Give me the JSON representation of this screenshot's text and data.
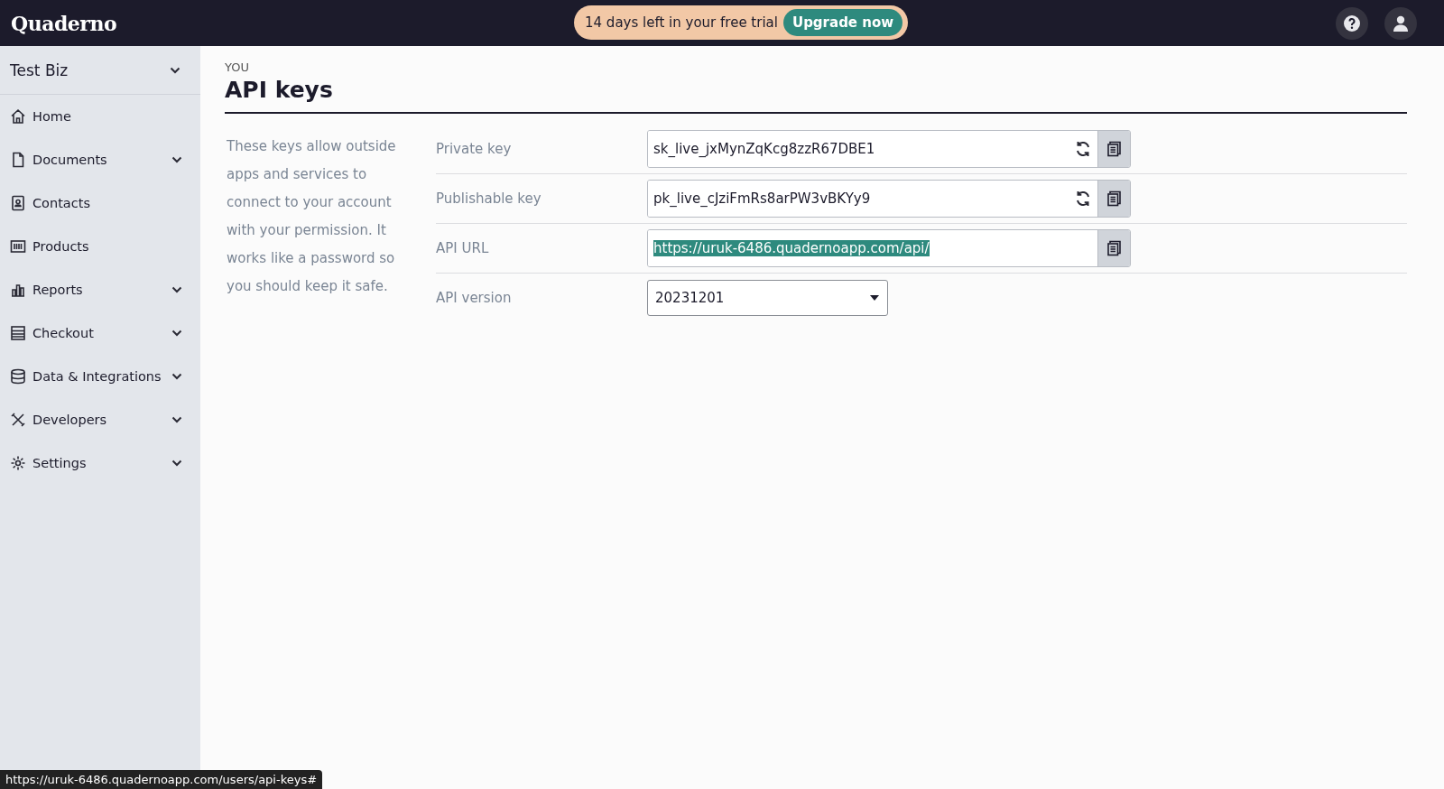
{
  "topbar": {
    "logo": "Quaderno",
    "trial_text": "14 days left in your free trial",
    "upgrade_button": "Upgrade now"
  },
  "sidebar": {
    "business": "Test Biz",
    "items": [
      {
        "label": "Home",
        "expandable": false
      },
      {
        "label": "Documents",
        "expandable": true
      },
      {
        "label": "Contacts",
        "expandable": false
      },
      {
        "label": "Products",
        "expandable": false
      },
      {
        "label": "Reports",
        "expandable": true
      },
      {
        "label": "Checkout",
        "expandable": true
      },
      {
        "label": "Data & Integrations",
        "expandable": true
      },
      {
        "label": "Developers",
        "expandable": true
      },
      {
        "label": "Settings",
        "expandable": true
      }
    ]
  },
  "page": {
    "breadcrumb": "YOU",
    "title": "API keys",
    "description": "These keys allow outside apps and services to connect to your account with your permission. It works like a password so you should keep it safe."
  },
  "fields": [
    {
      "kind": "key",
      "label": "Private key",
      "value": "sk_live_jxMynZqKcg8zzR67DBE1",
      "regenerate": true,
      "text_selected": false
    },
    {
      "kind": "key",
      "label": "Publishable key",
      "value": "pk_live_cJziFmRs8arPW3vBKYy9",
      "regenerate": true,
      "text_selected": false
    },
    {
      "kind": "key",
      "label": "API URL",
      "value": "https://uruk-6486.quadernoapp.com/api/",
      "regenerate": false,
      "text_selected": true
    },
    {
      "kind": "select",
      "label": "API version",
      "value": "20231201"
    }
  ],
  "status_bar": "https://uruk-6486.quadernoapp.com/users/api-keys#"
}
